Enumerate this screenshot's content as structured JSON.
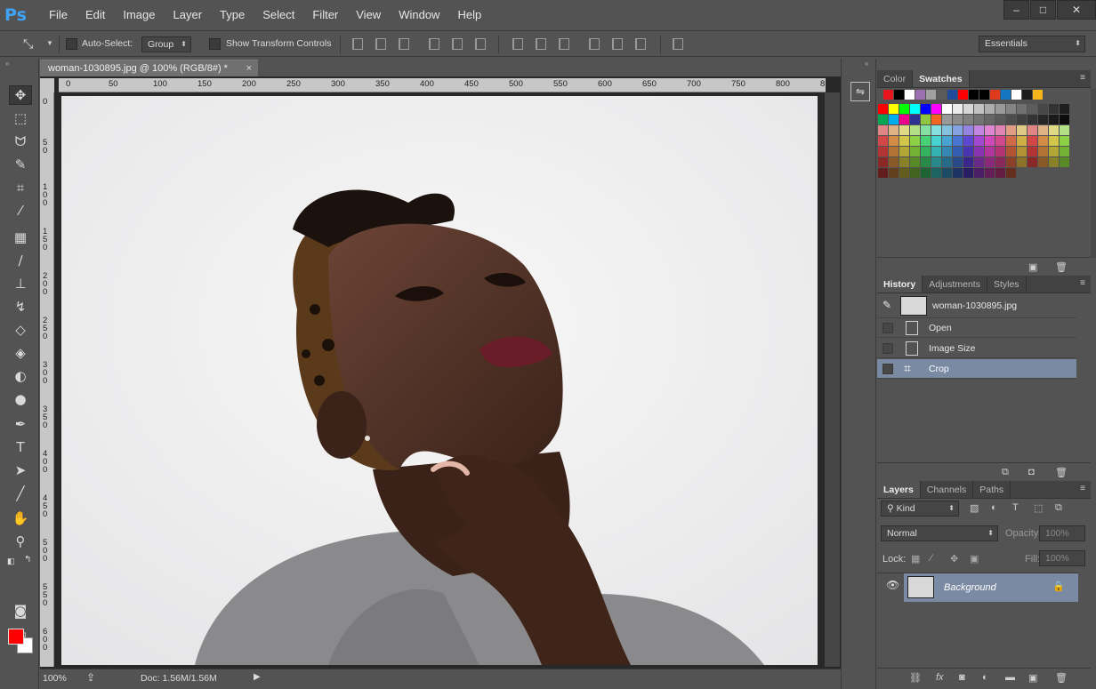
{
  "app": {
    "logo": "Ps"
  },
  "menu": [
    "File",
    "Edit",
    "Image",
    "Layer",
    "Type",
    "Select",
    "Filter",
    "View",
    "Window",
    "Help"
  ],
  "window_controls": {
    "minimize": "–",
    "maximize": "□",
    "close": "✕"
  },
  "options": {
    "auto_select_label": "Auto-Select:",
    "auto_select_value": "Group",
    "transform_label": "Show Transform Controls",
    "workspace": "Essentials"
  },
  "document": {
    "tab_title": "woman-1030895.jpg @ 100% (RGB/8#) *",
    "close": "×",
    "ruler_top": [
      "0",
      "50",
      "100",
      "150",
      "200",
      "250",
      "300",
      "350",
      "400",
      "450",
      "500",
      "550",
      "600",
      "650",
      "700",
      "750",
      "800",
      "8"
    ],
    "ruler_left": [
      "0",
      "5 0",
      "1 0 0",
      "1 5 0",
      "2 0 0",
      "2 5 0",
      "3 0 0",
      "3 5 0",
      "4 0 0",
      "4 5 0",
      "5 0 0",
      "5 5 0",
      "6 0 0"
    ]
  },
  "status": {
    "zoom": "100%",
    "doc": "Doc: 1.56M/1.56M"
  },
  "panels": {
    "color_tabs": [
      "Color",
      "Swatches"
    ],
    "history_tabs": [
      "History",
      "Adjustments",
      "Styles"
    ],
    "history_snapshot": "woman-1030895.jpg",
    "history_items": [
      "Open",
      "Image Size",
      "Crop"
    ],
    "layers_tabs": [
      "Layers",
      "Channels",
      "Paths"
    ],
    "kind_filter": "Kind",
    "blend_mode": "Normal",
    "opacity_label": "Opacity:",
    "opacity_value": "100%",
    "lock_label": "Lock:",
    "fill_label": "Fill:",
    "fill_value": "100%",
    "layer_name": "Background"
  },
  "colors": {
    "foreground": "#ff0000",
    "background": "#ffffff",
    "accent": "#7a8aa2"
  }
}
